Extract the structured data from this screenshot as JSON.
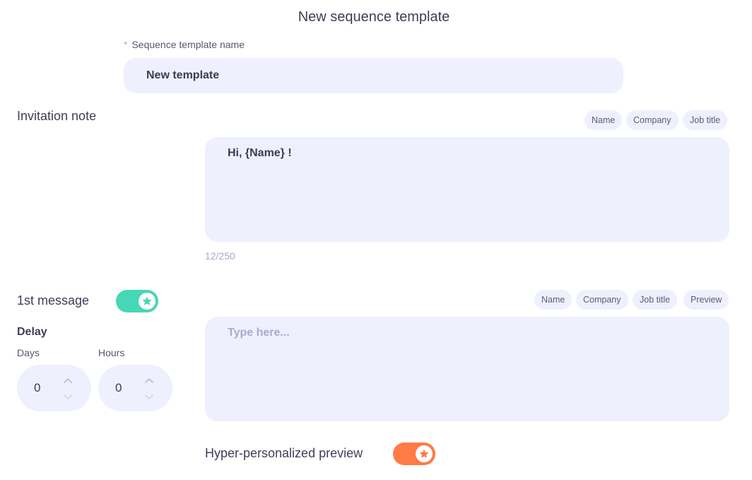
{
  "header": {
    "title": "New sequence template"
  },
  "template_name": {
    "required_marker": "*",
    "label": "Sequence template name",
    "value": "New template"
  },
  "invitation": {
    "title": "Invitation note",
    "chips": [
      "Name",
      "Company",
      "Job title"
    ],
    "message": "Hi, {Name} !",
    "counter": "12/250"
  },
  "first_message": {
    "title": "1st message",
    "toggle_on": true,
    "toggle_color": "#45d7b6",
    "chips": [
      "Name",
      "Company",
      "Job title",
      "Preview"
    ],
    "placeholder": "Type here...",
    "delay": {
      "title": "Delay",
      "days_label": "Days",
      "days_value": "0",
      "hours_label": "Hours",
      "hours_value": "0"
    }
  },
  "preview": {
    "label": "Hyper-personalized preview",
    "toggle_on": true,
    "toggle_color": "#ff7a45"
  }
}
